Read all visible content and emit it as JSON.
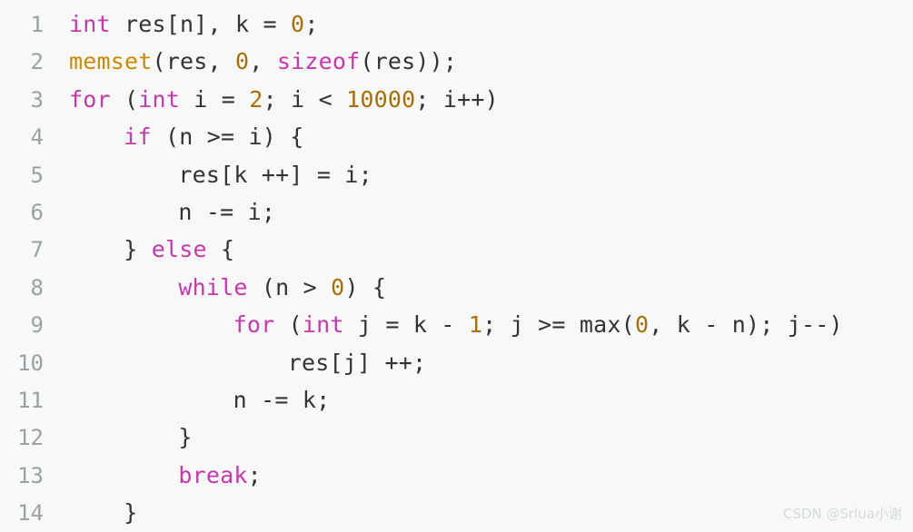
{
  "editor": {
    "language": "cpp",
    "background_color": "#f7f9f8",
    "line_number_color": "#9ca0a4",
    "colors": {
      "keyword": "#c837ab",
      "number": "#aa6e05",
      "function": "#cc8800",
      "plain": "#333333"
    },
    "lines": [
      {
        "number": "1",
        "indent": 0,
        "text": "int res[n], k = 0;",
        "tokens": [
          {
            "t": "int",
            "c": "kw"
          },
          {
            "t": " res[n], k = ",
            "c": "txt"
          },
          {
            "t": "0",
            "c": "num"
          },
          {
            "t": ";",
            "c": "txt"
          }
        ]
      },
      {
        "number": "2",
        "indent": 0,
        "text": "memset(res, 0, sizeof(res));",
        "tokens": [
          {
            "t": "memset",
            "c": "fn"
          },
          {
            "t": "(res, ",
            "c": "txt"
          },
          {
            "t": "0",
            "c": "num"
          },
          {
            "t": ", ",
            "c": "txt"
          },
          {
            "t": "sizeof",
            "c": "kw"
          },
          {
            "t": "(res));",
            "c": "txt"
          }
        ]
      },
      {
        "number": "3",
        "indent": 0,
        "text": "for (int i = 2; i < 10000; i++)",
        "tokens": [
          {
            "t": "for",
            "c": "kw"
          },
          {
            "t": " (",
            "c": "txt"
          },
          {
            "t": "int",
            "c": "kw"
          },
          {
            "t": " i = ",
            "c": "txt"
          },
          {
            "t": "2",
            "c": "num"
          },
          {
            "t": "; i < ",
            "c": "txt"
          },
          {
            "t": "10000",
            "c": "num"
          },
          {
            "t": "; i++)",
            "c": "txt"
          }
        ]
      },
      {
        "number": "4",
        "indent": 1,
        "text": "if (n >= i) {",
        "tokens": [
          {
            "t": "if",
            "c": "kw"
          },
          {
            "t": " (n >= i) {",
            "c": "txt"
          }
        ]
      },
      {
        "number": "5",
        "indent": 2,
        "text": "res[k ++] = i;",
        "tokens": [
          {
            "t": "res[k ++] = i;",
            "c": "txt"
          }
        ]
      },
      {
        "number": "6",
        "indent": 2,
        "text": "n -= i;",
        "tokens": [
          {
            "t": "n -= i;",
            "c": "txt"
          }
        ]
      },
      {
        "number": "7",
        "indent": 1,
        "text": "} else {",
        "tokens": [
          {
            "t": "} ",
            "c": "txt"
          },
          {
            "t": "else",
            "c": "kw"
          },
          {
            "t": " {",
            "c": "txt"
          }
        ]
      },
      {
        "number": "8",
        "indent": 2,
        "text": "while (n > 0) {",
        "tokens": [
          {
            "t": "while",
            "c": "kw"
          },
          {
            "t": " (n > ",
            "c": "txt"
          },
          {
            "t": "0",
            "c": "num"
          },
          {
            "t": ") {",
            "c": "txt"
          }
        ]
      },
      {
        "number": "9",
        "indent": 3,
        "text": "for (int j = k - 1; j >= max(0, k - n); j--)",
        "tokens": [
          {
            "t": "for",
            "c": "kw"
          },
          {
            "t": " (",
            "c": "txt"
          },
          {
            "t": "int",
            "c": "kw"
          },
          {
            "t": " j = k - ",
            "c": "txt"
          },
          {
            "t": "1",
            "c": "num"
          },
          {
            "t": "; j >= max(",
            "c": "txt"
          },
          {
            "t": "0",
            "c": "num"
          },
          {
            "t": ", k - n); j--)",
            "c": "txt"
          }
        ]
      },
      {
        "number": "10",
        "indent": 4,
        "text": "res[j] ++;",
        "tokens": [
          {
            "t": "res[j] ++;",
            "c": "txt"
          }
        ]
      },
      {
        "number": "11",
        "indent": 3,
        "text": "n -= k;",
        "tokens": [
          {
            "t": "n -= k;",
            "c": "txt"
          }
        ]
      },
      {
        "number": "12",
        "indent": 2,
        "text": "}",
        "tokens": [
          {
            "t": "}",
            "c": "txt"
          }
        ]
      },
      {
        "number": "13",
        "indent": 2,
        "text": "break;",
        "tokens": [
          {
            "t": "break",
            "c": "kw"
          },
          {
            "t": ";",
            "c": "txt"
          }
        ]
      },
      {
        "number": "14",
        "indent": 1,
        "text": "}",
        "tokens": [
          {
            "t": "}",
            "c": "txt"
          }
        ]
      }
    ]
  },
  "watermark": {
    "text": "CSDN @Srlua小谢",
    "color": "#d6d9db"
  }
}
